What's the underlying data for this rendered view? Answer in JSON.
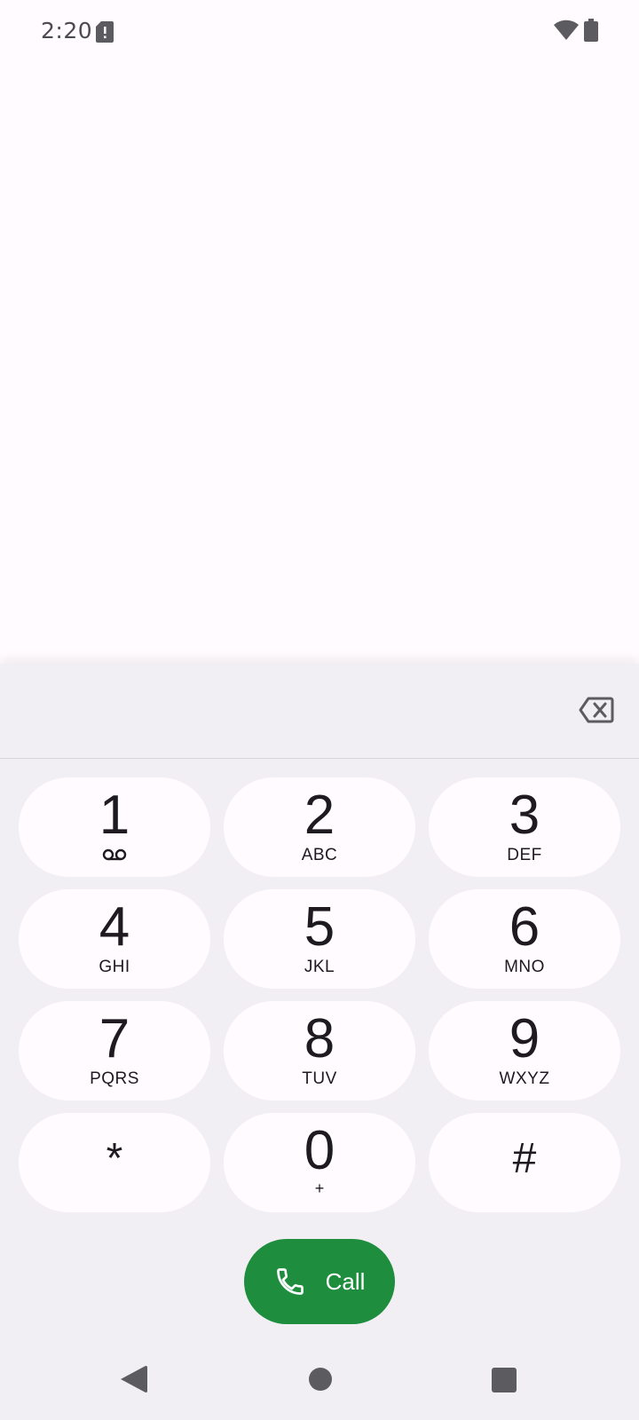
{
  "status_bar": {
    "time": "2:20",
    "icons": [
      "sim-alert-icon",
      "wifi-icon",
      "battery-icon"
    ]
  },
  "dialer": {
    "number": "",
    "keys": [
      {
        "digit": "1",
        "letters": "",
        "icon": "voicemail-icon"
      },
      {
        "digit": "2",
        "letters": "ABC"
      },
      {
        "digit": "3",
        "letters": "DEF"
      },
      {
        "digit": "4",
        "letters": "GHI"
      },
      {
        "digit": "5",
        "letters": "JKL"
      },
      {
        "digit": "6",
        "letters": "MNO"
      },
      {
        "digit": "7",
        "letters": "PQRS"
      },
      {
        "digit": "8",
        "letters": "TUV"
      },
      {
        "digit": "9",
        "letters": "WXYZ"
      },
      {
        "digit": "*",
        "letters": ""
      },
      {
        "digit": "0",
        "letters": "+"
      },
      {
        "digit": "#",
        "letters": ""
      }
    ],
    "call_label": "Call"
  },
  "colors": {
    "background": "#fffbfe",
    "panel": "#f2eff4",
    "call_button": "#1e8e3e",
    "icon_gray": "#5b5b60"
  },
  "nav": {
    "icons": [
      "back-icon",
      "home-icon",
      "recents-icon"
    ]
  }
}
